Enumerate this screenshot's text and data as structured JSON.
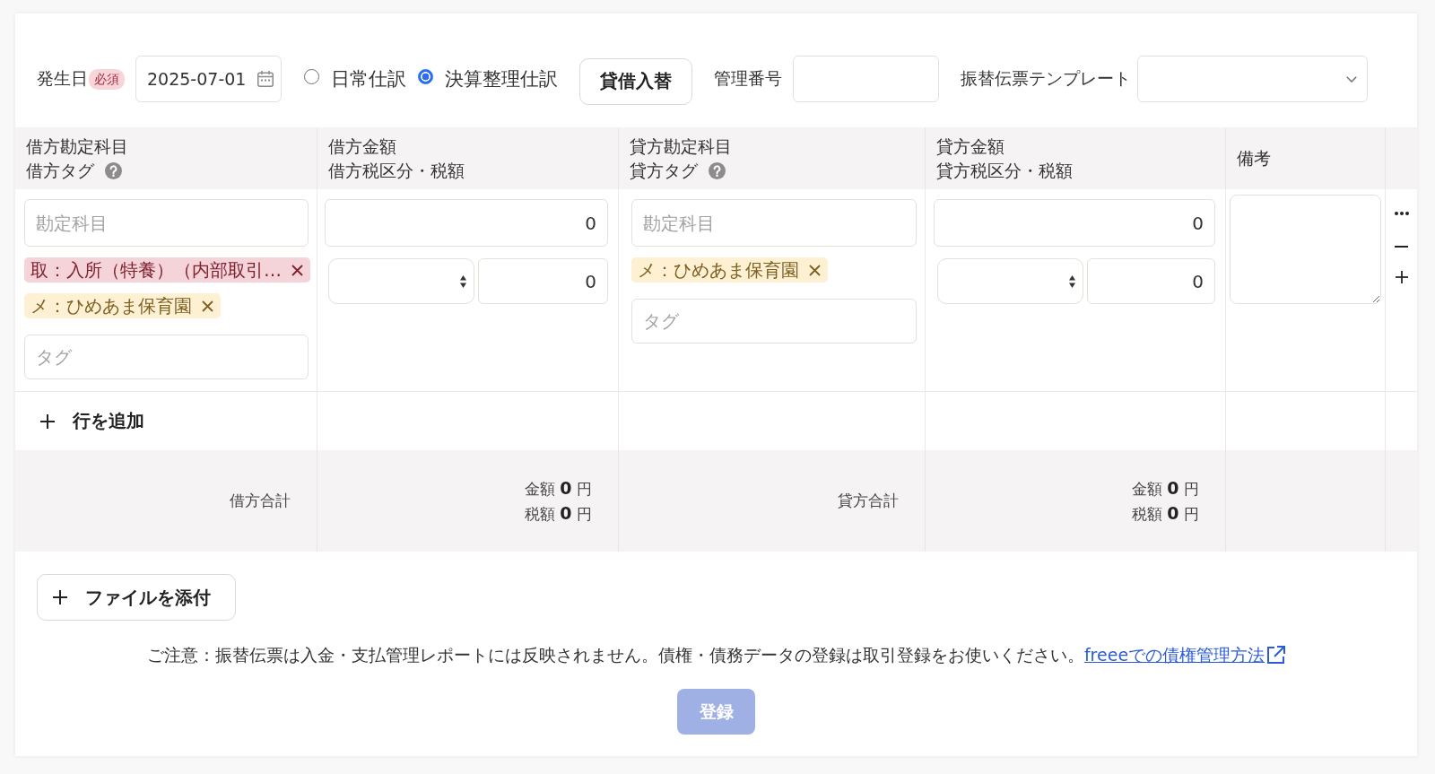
{
  "form_header": {
    "date_label": "発生日",
    "required_badge": "必須",
    "date_value": "2025-07-01",
    "journal_types": [
      {
        "label": "日常仕訳",
        "selected": false
      },
      {
        "label": "決算整理仕訳",
        "selected": true
      }
    ],
    "swap_button": "貸借入替",
    "management_number_label": "管理番号",
    "template_label": "振替伝票テンプレート"
  },
  "table": {
    "columns": [
      {
        "lines": [
          "借方勘定科目",
          "借方タグ"
        ],
        "help": true
      },
      {
        "lines": [
          "借方金額",
          "借方税区分・税額"
        ],
        "help": false
      },
      {
        "lines": [
          "貸方勘定科目",
          "貸方タグ"
        ],
        "help": true
      },
      {
        "lines": [
          "貸方金額",
          "貸方税区分・税額"
        ],
        "help": false
      },
      {
        "lines": [
          "備考"
        ],
        "help": false
      }
    ],
    "rows": [
      {
        "debit": {
          "account_placeholder": "勘定科目",
          "tags": [
            {
              "label": "取：入所（特養）（内部取引…",
              "color": "#f4d4d9"
            },
            {
              "label": "メ：ひめあま保育園",
              "color": "#fdf0d3"
            }
          ],
          "tag_placeholder": "タグ",
          "amount": "0",
          "tax_amount": "0"
        },
        "credit": {
          "account_placeholder": "勘定科目",
          "tags": [
            {
              "label": "メ：ひめあま保育園",
              "color": "#fdf0d3"
            }
          ],
          "tag_placeholder": "タグ",
          "amount": "0",
          "tax_amount": "0"
        }
      }
    ],
    "add_row_button": "行を追加",
    "totals": [
      {
        "label": "借方合計",
        "lines": [
          "金額 **0** 円",
          "税額 **0** 円"
        ]
      },
      {
        "label": "貸方合計",
        "lines": [
          "金額 **0** 円",
          "税額 **0** 円"
        ]
      }
    ]
  },
  "attach_button": "ファイルを添付",
  "notice": {
    "text": "ご注意：振替伝票は入金・支払管理レポートには反映されません。債権・債務データの登録は取引登録をお使いください。",
    "link": "freeeでの債権管理方法"
  },
  "submit_button": {
    "label": "登録",
    "disabled": true
  }
}
